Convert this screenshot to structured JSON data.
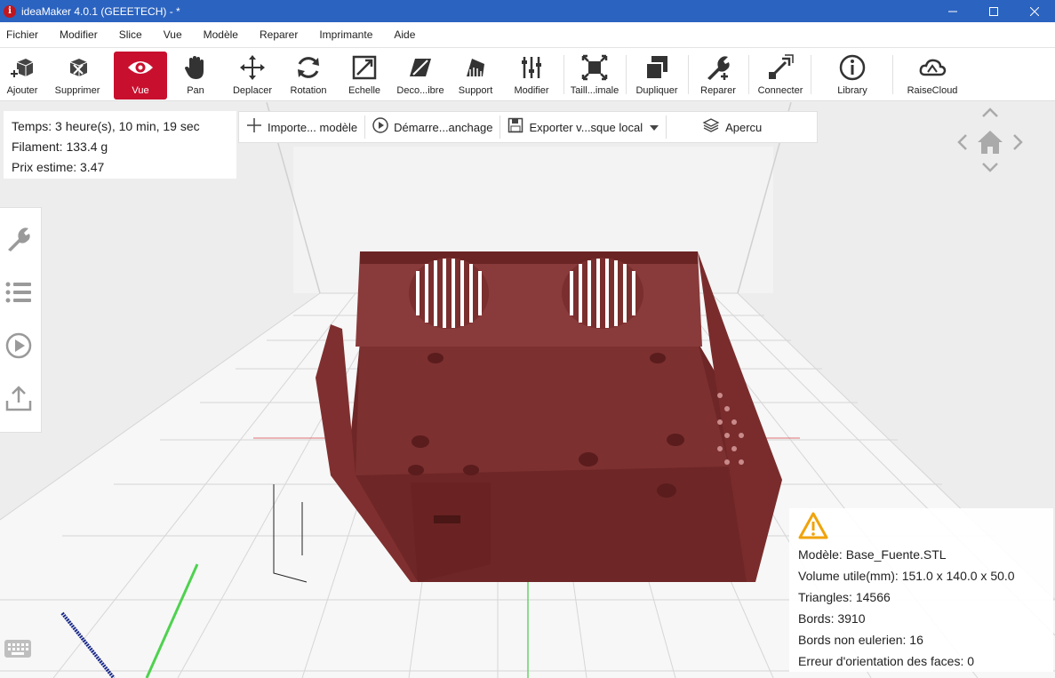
{
  "window": {
    "title": "ideaMaker 4.0.1 (GEEETECH) - *",
    "app_icon_letter": "i",
    "controls": [
      "minimize",
      "maximize",
      "close"
    ]
  },
  "menu": [
    "Fichier",
    "Modifier",
    "Slice",
    "Vue",
    "Modèle",
    "Reparer",
    "Imprimante",
    "Aide"
  ],
  "toolbar": [
    {
      "label": "Ajouter",
      "icon": "add-cube-icon",
      "active": false
    },
    {
      "label": "Supprimer",
      "icon": "delete-cube-icon",
      "active": false
    },
    {
      "label": "Vue",
      "icon": "eye-icon",
      "active": true
    },
    {
      "label": "Pan",
      "icon": "hand-icon",
      "active": false
    },
    {
      "label": "Deplacer",
      "icon": "move-arrows-icon",
      "active": false
    },
    {
      "label": "Rotation",
      "icon": "rotate-icon",
      "active": false
    },
    {
      "label": "Echelle",
      "icon": "scale-icon",
      "active": false
    },
    {
      "label": "Deco...ibre",
      "icon": "cut-icon",
      "active": false
    },
    {
      "label": "Support",
      "icon": "support-icon",
      "active": false
    },
    {
      "label": "Modifier",
      "icon": "sliders-icon",
      "active": false
    },
    {
      "label": "Taill...imale",
      "icon": "maximize-icon",
      "active": false
    },
    {
      "label": "Dupliquer",
      "icon": "duplicate-icon",
      "active": false
    },
    {
      "label": "Reparer",
      "icon": "repair-wrench-icon",
      "active": false
    },
    {
      "label": "Connecter",
      "icon": "connect-icon",
      "active": false
    },
    {
      "label": "Library",
      "icon": "info-icon",
      "active": false
    },
    {
      "label": "RaiseCloud",
      "icon": "cloud-icon",
      "active": false
    }
  ],
  "info": {
    "time": "Temps: 3 heure(s), 10 min, 19 sec",
    "filament": "Filament: 133.4 g",
    "price": "Prix estime: 3.47"
  },
  "actions": {
    "import": "Importe... modèle",
    "start": "Démarre...anchage",
    "export": "Exporter v...sque local",
    "preview": "Apercu"
  },
  "side_icons": [
    "wrench-icon",
    "list-icon",
    "play-icon",
    "upload-icon"
  ],
  "model_info": {
    "model": "Modèle: Base_Fuente.STL",
    "volume": "Volume utile(mm): 151.0 x 140.0 x 50.0",
    "triangles": "Triangles: 14566",
    "edges": "Bords: 3910",
    "non_eulerian": "Bords non eulerien: 16",
    "orientation_error": "Erreur d'orientation des faces: 0"
  },
  "colors": {
    "titlebar": "#2b63c0",
    "active_tool": "#c8102e",
    "model": "#7a2e2e",
    "warning": "#f0a30a"
  }
}
